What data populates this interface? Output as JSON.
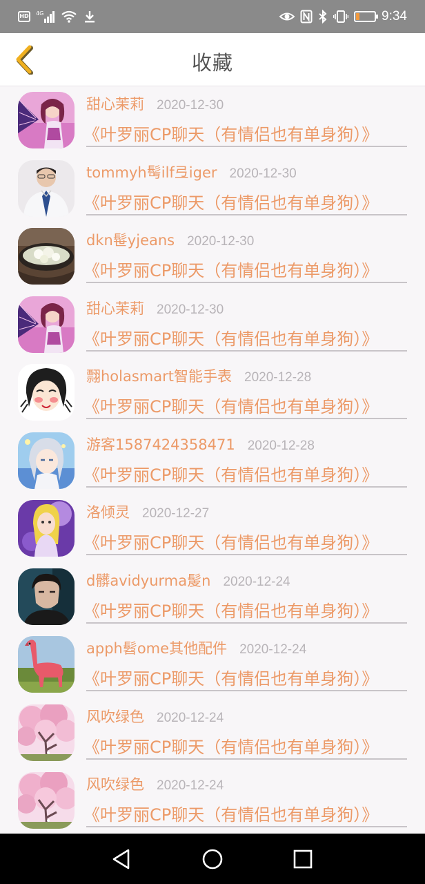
{
  "status_bar": {
    "hd_badge": "HD",
    "network": "4G",
    "time": "9:34",
    "battery_level": 0.2,
    "icons": [
      "hd-icon",
      "signal-icon",
      "wifi-icon",
      "download-icon",
      "eye-comfort-icon",
      "nfc-icon",
      "bluetooth-icon",
      "vibrate-icon",
      "battery-icon"
    ]
  },
  "header": {
    "back_icon": "chevron-left-icon",
    "title": "收藏"
  },
  "favorites": [
    {
      "name": "甜心茉莉",
      "date": "2020-12-30",
      "room": "《叶罗丽CP聊天（有情侣也有单身狗）》",
      "avatar": "anime-girl-fan"
    },
    {
      "name": "tommyh髩ilf弖iger",
      "date": "2020-12-30",
      "room": "《叶罗丽CP聊天（有情侣也有单身狗）》",
      "avatar": "man-shirt-tie"
    },
    {
      "name": "dkn髰yjeans",
      "date": "2020-12-30",
      "room": "《叶罗丽CP聊天（有情侣也有单身狗）》",
      "avatar": "bowl-dumplings"
    },
    {
      "name": "甜心茉莉",
      "date": "2020-12-30",
      "room": "《叶罗丽CP聊天（有情侣也有单身狗）》",
      "avatar": "anime-girl-fan"
    },
    {
      "name": "翲holasmart智能手表",
      "date": "2020-12-28",
      "room": "《叶罗丽CP聊天（有情侣也有单身狗）》",
      "avatar": "cartoon-girl-blush"
    },
    {
      "name": "游客1587424358471",
      "date": "2020-12-28",
      "room": "《叶罗丽CP聊天（有情侣也有单身狗）》",
      "avatar": "anime-silver-hair"
    },
    {
      "name": "洛倾灵",
      "date": "2020-12-27",
      "room": "《叶罗丽CP聊天（有情侣也有单身狗）》",
      "avatar": "doll-purple"
    },
    {
      "name": "d髒avidyurma髲n",
      "date": "2020-12-24",
      "room": "《叶罗丽CP聊天（有情侣也有单身狗）》",
      "avatar": "man-portrait"
    },
    {
      "name": "apph髫ome其他配件",
      "date": "2020-12-24",
      "room": "《叶罗丽CP聊天（有情侣也有单身狗）》",
      "avatar": "pink-llama"
    },
    {
      "name": "风吹绿色",
      "date": "2020-12-24",
      "room": "《叶罗丽CP聊天（有情侣也有单身狗）》",
      "avatar": "cherry-blossom"
    },
    {
      "name": "风吹绿色",
      "date": "2020-12-24",
      "room": "《叶罗丽CP聊天（有情侣也有单身狗）》",
      "avatar": "cherry-blossom"
    }
  ],
  "nav_bar": {
    "icons": [
      "back-triangle-icon",
      "home-circle-icon",
      "recents-square-icon"
    ]
  },
  "colors": {
    "accent": "#ec9a68",
    "back_chevron": "#f0b020",
    "date": "#b8b4b8",
    "status_bar": "#8a8a8a"
  }
}
